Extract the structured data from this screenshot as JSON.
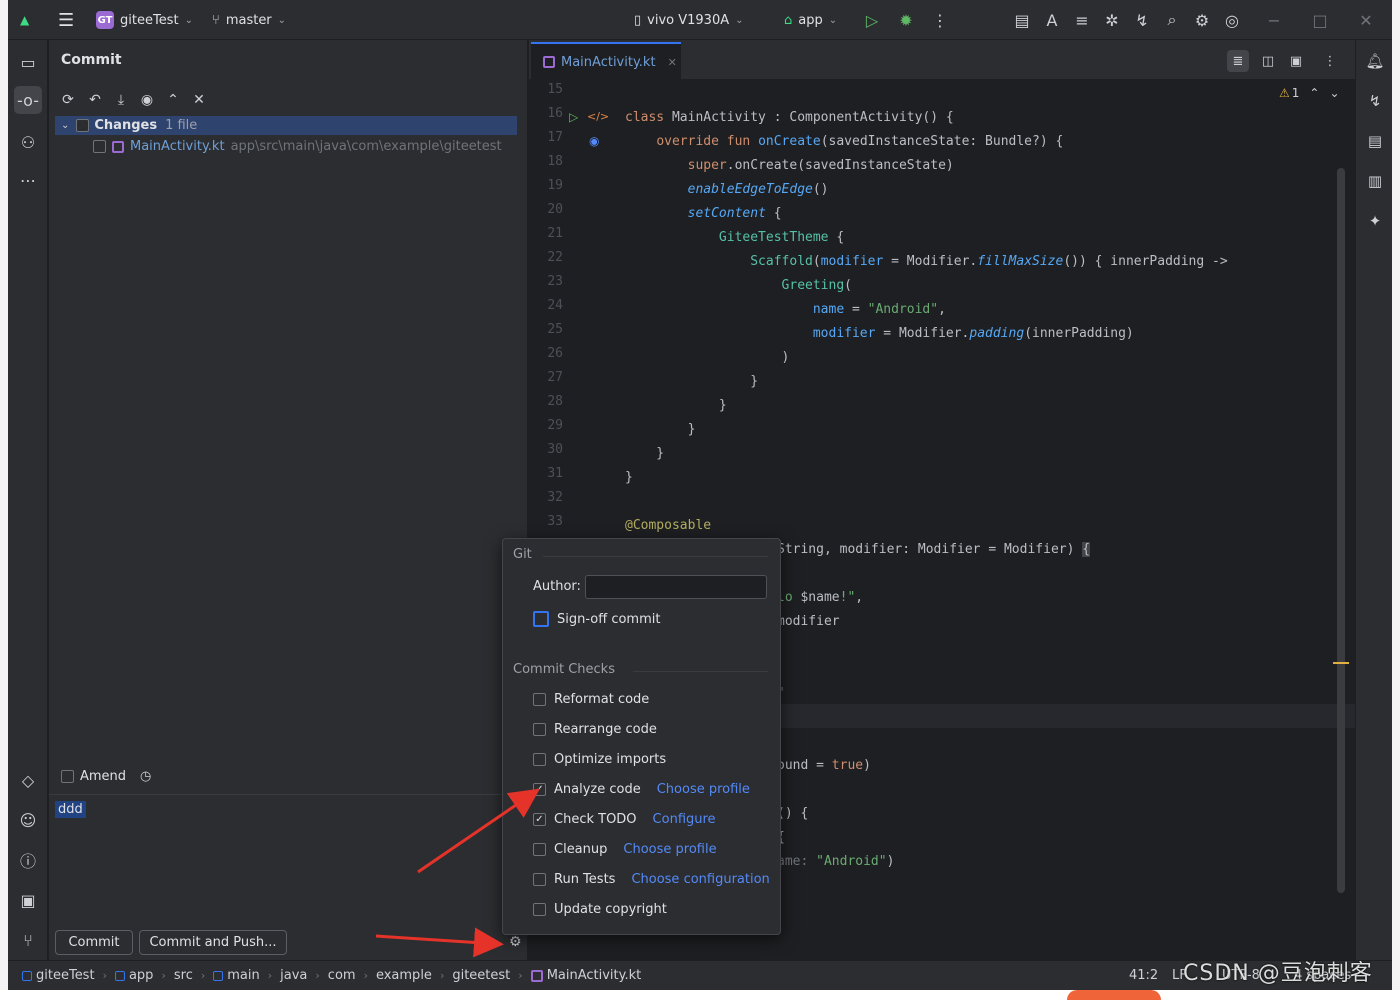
{
  "titlebar": {
    "project_badge": "GT",
    "project_name": "giteeTest",
    "branch": "master",
    "device": "vivo V1930A",
    "run_config": "app"
  },
  "commit_panel": {
    "title": "Commit",
    "changes_label": "Changes",
    "changes_count": "1 file",
    "file_name": "MainActivity.kt",
    "file_path": "app\\src\\main\\java\\com\\example\\giteetest",
    "amend_label": "Amend",
    "commit_message": "ddd",
    "commit_button": "Commit",
    "commit_push_button": "Commit and Push..."
  },
  "editor": {
    "tab_name": "MainActivity.kt",
    "warning_count": "1",
    "line_numbers": [
      "15",
      "16",
      "17",
      "18",
      "19",
      "20",
      "21",
      "22",
      "23",
      "24",
      "25",
      "26",
      "27",
      "28",
      "29",
      "30",
      "31",
      "32",
      "33"
    ]
  },
  "popup": {
    "git_section": "Git",
    "author_label": "Author:",
    "author_value": "",
    "signoff_label": "Sign-off commit",
    "checks_section": "Commit Checks",
    "checks": [
      {
        "label": "Reformat code",
        "checked": false,
        "link": ""
      },
      {
        "label": "Rearrange code",
        "checked": false,
        "link": ""
      },
      {
        "label": "Optimize imports",
        "checked": false,
        "link": ""
      },
      {
        "label": "Analyze code",
        "checked": true,
        "link": "Choose profile"
      },
      {
        "label": "Check TODO",
        "checked": true,
        "link": "Configure"
      },
      {
        "label": "Cleanup",
        "checked": false,
        "link": "Choose profile"
      },
      {
        "label": "Run Tests",
        "checked": false,
        "link": "Choose configuration"
      },
      {
        "label": "Update copyright",
        "checked": false,
        "link": ""
      }
    ]
  },
  "statusbar": {
    "crumbs": [
      "giteeTest",
      "app",
      "src",
      "main",
      "java",
      "com",
      "example",
      "giteetest",
      "MainActivity.kt"
    ],
    "position": "41:2",
    "line_sep": "LF",
    "encoding": "UTF-8",
    "indent": "4 spaces"
  },
  "watermark": "CSDN @豆泡刺客",
  "colors": {
    "accent": "#3574f0",
    "selection": "#2e436e",
    "link": "#548af7",
    "kotlin": "#9b6ad3",
    "arrow": "#e5332a"
  }
}
